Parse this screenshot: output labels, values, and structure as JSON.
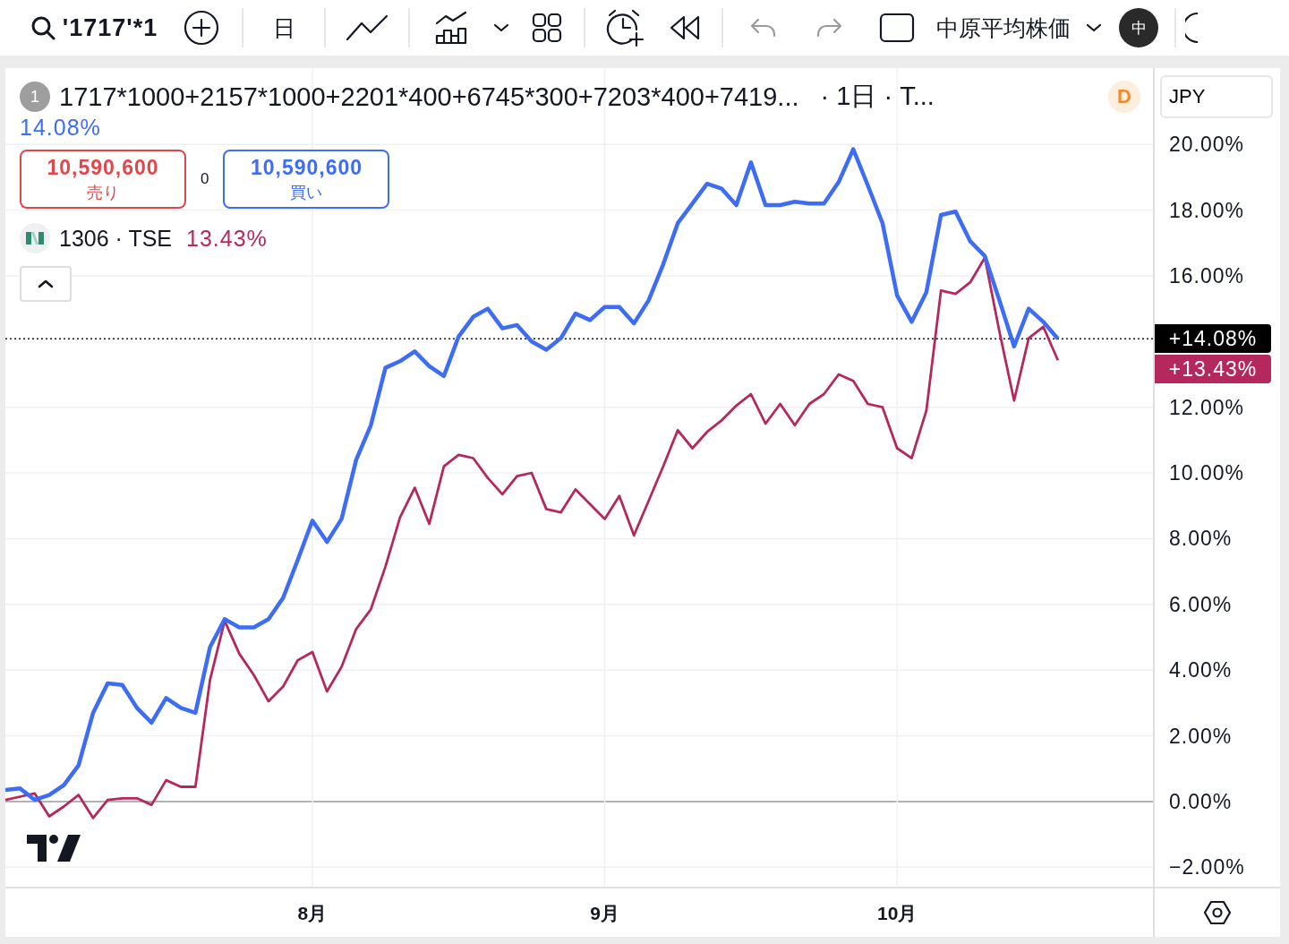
{
  "toolbar": {
    "symbol": "'1717'*1",
    "interval": "日",
    "layout_name": "中原平均株価",
    "avatar": "中",
    "undo": {
      "disabled": true
    },
    "redo": {
      "disabled": true
    }
  },
  "legend": {
    "main": {
      "badge": "1",
      "interval": "· 1日 · T...",
      "source_badge": "D",
      "change": "14.08%"
    },
    "trade": {
      "sell_price": "10,590,600",
      "sell_label": "売り",
      "spread": "0",
      "buy_price": "10,590,600",
      "buy_label": "買い"
    },
    "compare": [
      {
        "symbol": "1306 · TSE",
        "change": "13.43%"
      }
    ]
  },
  "price_axis": {
    "currency": "JPY",
    "tags": [
      {
        "text": "+14.08%",
        "color": "#000000"
      },
      {
        "text": "+13.43%",
        "color": "#b5285e"
      }
    ]
  },
  "chart_data": {
    "type": "line",
    "categories": [
      null,
      null,
      null,
      null,
      null,
      null,
      null,
      null,
      null,
      null,
      null,
      null,
      null,
      null,
      null,
      null,
      null,
      null,
      null,
      null,
      null,
      "8月",
      null,
      null,
      null,
      null,
      null,
      null,
      null,
      null,
      null,
      null,
      null,
      null,
      null,
      null,
      null,
      null,
      null,
      null,
      null,
      "9月",
      null,
      null,
      null,
      null,
      null,
      null,
      null,
      null,
      null,
      null,
      null,
      null,
      null,
      null,
      null,
      null,
      null,
      null,
      null,
      "10月",
      null,
      null,
      null,
      null,
      null,
      null,
      null,
      null,
      null,
      null,
      null
    ],
    "ylim": [
      -2.59,
      22.32
    ],
    "grid": true,
    "ref_lines": [
      {
        "axis": "y",
        "value": 14.08
      }
    ],
    "yticks": [
      {
        "value": 20,
        "label": "20.00%"
      },
      {
        "value": 18,
        "label": "18.00%"
      },
      {
        "value": 16,
        "label": "16.00%"
      },
      {
        "value": 12,
        "label": "12.00%"
      },
      {
        "value": 10,
        "label": "10.00%"
      },
      {
        "value": 8,
        "label": "8.00%"
      },
      {
        "value": 6,
        "label": "6.00%"
      },
      {
        "value": 4,
        "label": "4.00%"
      },
      {
        "value": 2,
        "label": "2.00%"
      },
      {
        "value": 0,
        "label": "0.00%"
      },
      {
        "value": -2,
        "label": "−2.00%"
      }
    ],
    "series": [
      {
        "name": "1717*1000+2157*1000+2201*400+6745*300+7203*400+7419...",
        "color": "#3d6cf5",
        "values": [
          0.35,
          0.4,
          0.05,
          0.2,
          0.5,
          1.1,
          2.7,
          3.6,
          3.55,
          2.85,
          2.4,
          3.15,
          2.85,
          2.7,
          4.7,
          5.55,
          5.3,
          5.3,
          5.55,
          6.2,
          7.35,
          8.55,
          7.9,
          8.6,
          10.4,
          11.45,
          13.2,
          13.4,
          13.7,
          13.25,
          12.95,
          14.15,
          14.75,
          15.0,
          14.4,
          14.5,
          14.0,
          13.75,
          14.1,
          14.85,
          14.65,
          15.05,
          15.05,
          14.55,
          15.25,
          16.35,
          17.6,
          18.2,
          18.8,
          18.65,
          18.15,
          19.45,
          18.15,
          18.15,
          18.25,
          18.2,
          18.2,
          18.85,
          19.85,
          18.75,
          17.6,
          15.4,
          14.6,
          15.5,
          17.85,
          17.95,
          17.05,
          16.6,
          15.25,
          13.85,
          15.0,
          14.6,
          14.08
        ]
      },
      {
        "color": "#b5285e",
        "values": [
          0.05,
          0.15,
          0.25,
          -0.45,
          -0.15,
          0.2,
          -0.5,
          0.05,
          0.1,
          0.1,
          -0.1,
          0.65,
          0.45,
          0.45,
          3.7,
          5.5,
          4.5,
          3.85,
          3.05,
          3.5,
          4.3,
          4.55,
          3.35,
          4.1,
          5.25,
          5.85,
          7.15,
          8.65,
          9.55,
          8.45,
          10.2,
          10.55,
          10.45,
          9.85,
          9.35,
          9.9,
          10.0,
          8.9,
          8.8,
          9.5,
          9.05,
          8.6,
          9.3,
          8.1,
          9.15,
          10.2,
          11.3,
          10.75,
          11.25,
          11.6,
          12.05,
          12.4,
          11.5,
          12.1,
          11.45,
          12.1,
          12.4,
          13.0,
          12.8,
          12.1,
          12.0,
          10.75,
          10.45,
          11.9,
          15.55,
          15.45,
          15.8,
          16.55,
          14.3,
          12.2,
          14.1,
          14.45,
          13.43
        ]
      }
    ]
  }
}
